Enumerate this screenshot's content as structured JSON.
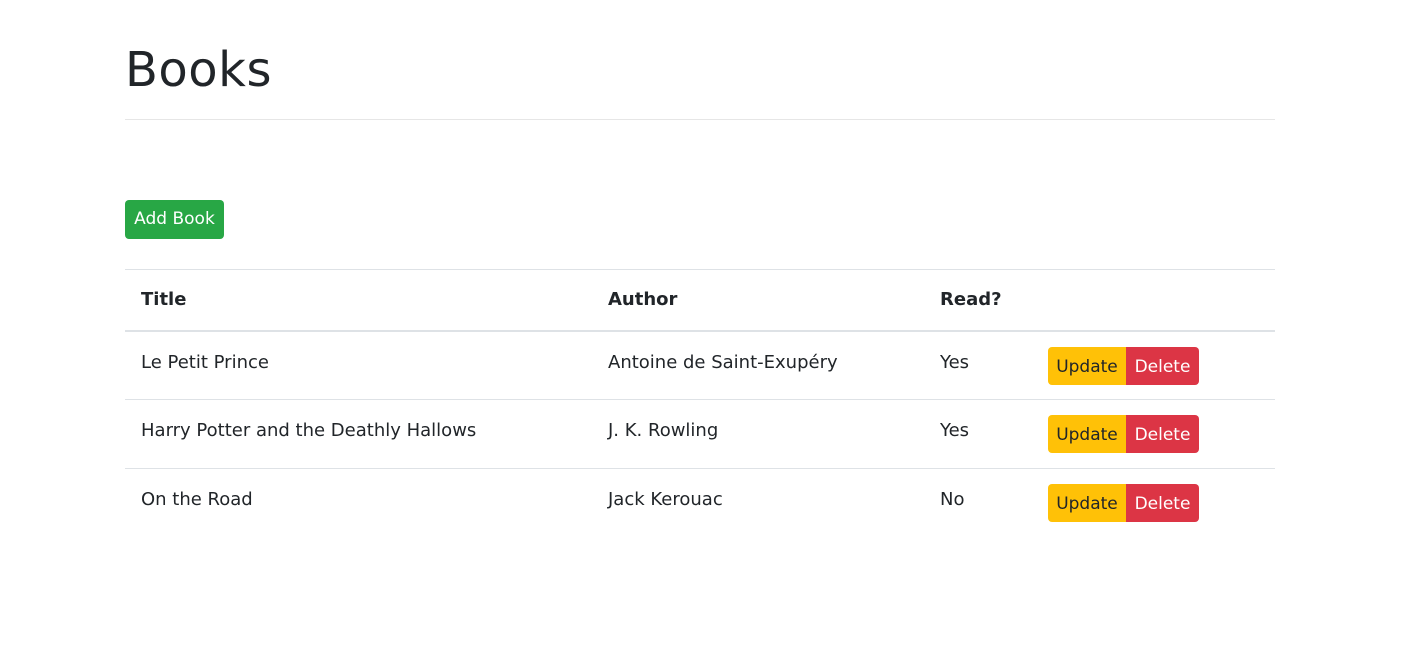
{
  "page": {
    "title": "Books"
  },
  "toolbar": {
    "add_label": "Add Book"
  },
  "table": {
    "headers": [
      "Title",
      "Author",
      "Read?"
    ],
    "rows": [
      {
        "title": "Le Petit Prince",
        "author": "Antoine de Saint-Exupéry",
        "read": "Yes"
      },
      {
        "title": "Harry Potter and the Deathly Hallows",
        "author": "J. K. Rowling",
        "read": "Yes"
      },
      {
        "title": "On the Road",
        "author": "Jack Kerouac",
        "read": "No"
      }
    ],
    "update_label": "Update",
    "delete_label": "Delete"
  },
  "colors": {
    "add": "#28a745",
    "update": "#ffc107",
    "delete": "#dc3545"
  }
}
